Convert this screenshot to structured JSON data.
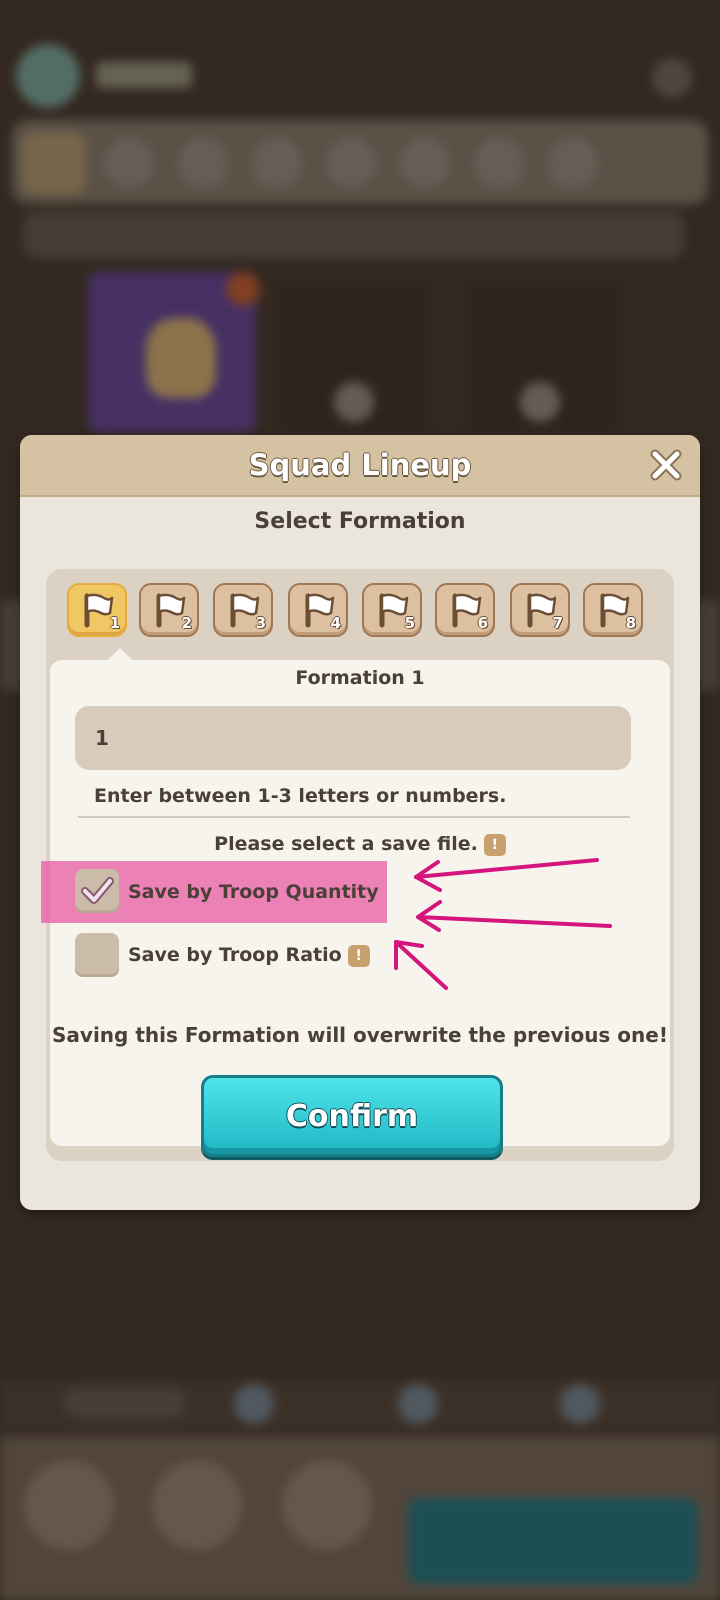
{
  "dialog": {
    "title": "Squad Lineup",
    "close_icon": "close-icon",
    "subtitle": "Select Formation",
    "formation_tabs": [
      {
        "number": "1",
        "active": true
      },
      {
        "number": "2",
        "active": false
      },
      {
        "number": "3",
        "active": false
      },
      {
        "number": "4",
        "active": false
      },
      {
        "number": "5",
        "active": false
      },
      {
        "number": "6",
        "active": false
      },
      {
        "number": "7",
        "active": false
      },
      {
        "number": "8",
        "active": false
      }
    ],
    "formation_name": "Formation 1",
    "name_input_value": "1",
    "name_hint": "Enter between 1-3 letters or numbers.",
    "save_file_label": "Please select a save file.",
    "options": [
      {
        "label": "Save by Troop Quantity",
        "checked": true
      },
      {
        "label": "Save by Troop Ratio",
        "checked": false
      }
    ],
    "warning": "Saving this Formation will overwrite the previous one!",
    "confirm_label": "Confirm"
  },
  "colors": {
    "confirm_button": "#2fc6d1",
    "active_tab": "#f1c764",
    "annotation": "#d4157d"
  }
}
